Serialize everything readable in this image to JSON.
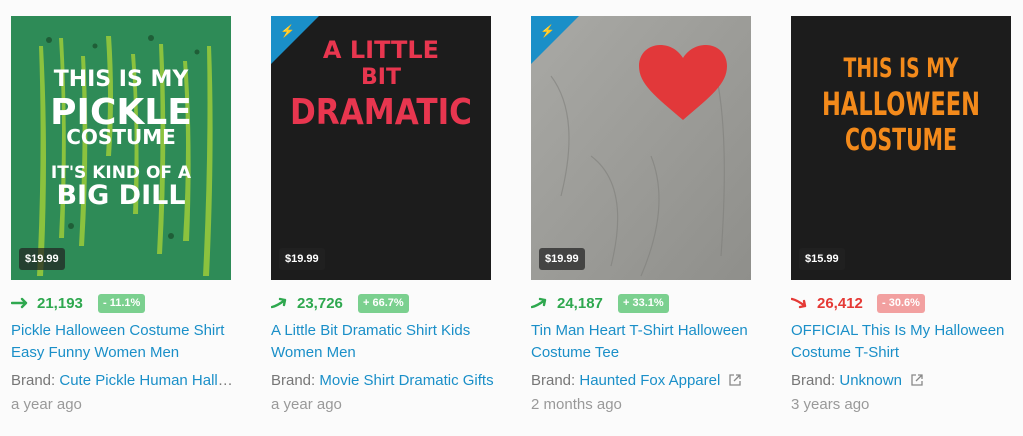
{
  "colors": {
    "accent": "#1a8fc8",
    "up": "#2fa84f",
    "down": "#e53935",
    "badge_up": "#7bd08f",
    "badge_down": "#f2a0a0"
  },
  "cards": [
    {
      "price": "$19.99",
      "rank": "21,193",
      "change": "- 11.1%",
      "title": "Pickle Halloween Costume Shirt Easy Funny Women Men",
      "brand_label": "Brand:",
      "brand": "Cute Pickle Human Halloween...",
      "age": "a year ago",
      "art_lines": [
        "THIS IS MY",
        "PICKLE",
        "COSTUME",
        "IT'S KIND OF A",
        "BIG DILL"
      ]
    },
    {
      "price": "$19.99",
      "rank": "23,726",
      "change": "+ 66.7%",
      "title": "A Little Bit Dramatic Shirt Kids Women Men",
      "brand_label": "Brand:",
      "brand": "Movie Shirt Dramatic Gifts",
      "age": "a year ago",
      "art_lines": [
        "A LITTLE",
        "BIT",
        "DRAMATIC"
      ]
    },
    {
      "price": "$19.99",
      "rank": "24,187",
      "change": "+ 33.1%",
      "title": "Tin Man Heart T-Shirt Halloween Costume Tee",
      "brand_label": "Brand:",
      "brand": "Haunted Fox Apparel",
      "age": "2 months ago",
      "art_lines": []
    },
    {
      "price": "$15.99",
      "rank": "26,412",
      "change": "- 30.6%",
      "title": "OFFICIAL This Is My Halloween Costume T-Shirt",
      "brand_label": "Brand:",
      "brand": "Unknown",
      "age": "3 years ago",
      "art_lines": [
        "THIS IS MY",
        "HALLOWEEN",
        "COSTUME"
      ]
    }
  ]
}
